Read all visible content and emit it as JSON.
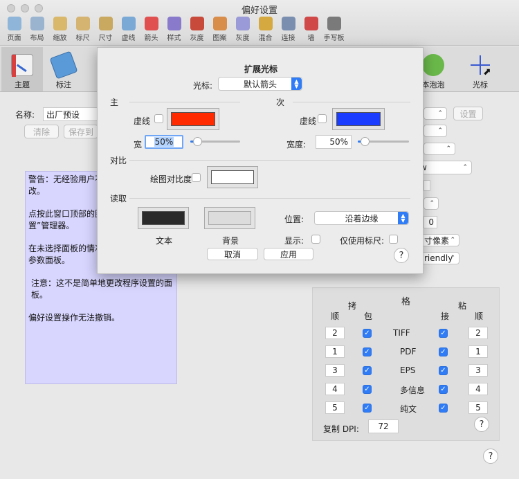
{
  "window": {
    "title": "偏好设置"
  },
  "toolbar": [
    {
      "label": "页面",
      "color": "#8fb6d8"
    },
    {
      "label": "布局",
      "color": "#9ab4d0"
    },
    {
      "label": "缩放",
      "color": "#d9b86b"
    },
    {
      "label": "标尺",
      "color": "#d5b472"
    },
    {
      "label": "尺寸",
      "color": "#c9a860"
    },
    {
      "label": "虚线",
      "color": "#7aa9d6"
    },
    {
      "label": "箭头",
      "color": "#e05050"
    },
    {
      "label": "样式",
      "color": "#8a7acb"
    },
    {
      "label": "灰度",
      "color": "#c84a3a"
    },
    {
      "label": "图案",
      "color": "#d88d4a"
    },
    {
      "label": "灰度",
      "color": "#9a9ad8"
    },
    {
      "label": "混合",
      "color": "#d6a940"
    },
    {
      "label": "连接",
      "color": "#7a8fb0"
    },
    {
      "label": "墙",
      "color": "#d04848"
    },
    {
      "label": "手写板",
      "color": "#7a7a7a"
    }
  ],
  "tabs": [
    {
      "label": "主题",
      "color": "#d84040"
    },
    {
      "label": "标注",
      "color": "#5a9ad8"
    },
    {
      "label": "本泡泡",
      "color": "#6ab84a"
    },
    {
      "label": "光标",
      "color": "#3a5ad0"
    }
  ],
  "background": {
    "name_label": "名称:",
    "name_value": "出厂预设",
    "clear_button": "清除",
    "save_to_button": "保存到",
    "settings_button": "设置",
    "select_w_suffix": "w",
    "field_zero": "0",
    "pixels_select": "寸像素",
    "friendly_select": "riendly",
    "warning": [
      "警告：无经验用户不应对此进行任何更改。",
      "点按此窗口顶部的图标来选择“偏好设置”管理器。",
      "在未选择面板的情况下，将会重置所有参数面板。",
      "注意：这不是简单地更改程序设置的面板。",
      "偏好设置操作无法撤销。"
    ]
  },
  "grid_panel": {
    "title": "格",
    "copy_header": "拷",
    "paste_header": "粘",
    "col_order_left": "顺",
    "col_include": "包",
    "col_accept": "接",
    "col_order_right": "顺",
    "rows": [
      {
        "left": "2",
        "format": "TIFF",
        "right": "2"
      },
      {
        "left": "1",
        "format": "PDF",
        "right": "1"
      },
      {
        "left": "3",
        "format": "EPS",
        "right": "3"
      },
      {
        "left": "4",
        "format": "多信息",
        "right": "4"
      },
      {
        "left": "5",
        "format": "纯文",
        "right": "5"
      }
    ],
    "dpi_label": "复制 DPI:",
    "dpi_value": "72"
  },
  "sheet": {
    "title": "扩展光标",
    "cursor_label": "光标:",
    "cursor_value": "默认箭头",
    "primary_label": "主",
    "secondary_label": "次",
    "dash_label": "虚线",
    "width_label_primary": "宽",
    "width_label_secondary": "宽度:",
    "primary_width": "50%",
    "secondary_width": "50%",
    "primary_width_level": 0.08,
    "secondary_width_level": 0.08,
    "primary_color": "#ff2a00",
    "secondary_color": "#1a3cff",
    "contrast_label": "对比",
    "draw_contrast_label": "绘图对比度",
    "contrast_color": "#ffffff",
    "readout_label": "读取",
    "text_label": "文本",
    "bg_label": "背景",
    "text_color": "#2a2a2a",
    "bg_color": "#dcdcdc",
    "position_label": "位置:",
    "position_value": "沿着边缘",
    "display_label": "显示:",
    "ruler_only_label": "仅使用标尺:",
    "cancel_button": "取消",
    "apply_button": "应用",
    "help": "?"
  },
  "help_global": "?"
}
